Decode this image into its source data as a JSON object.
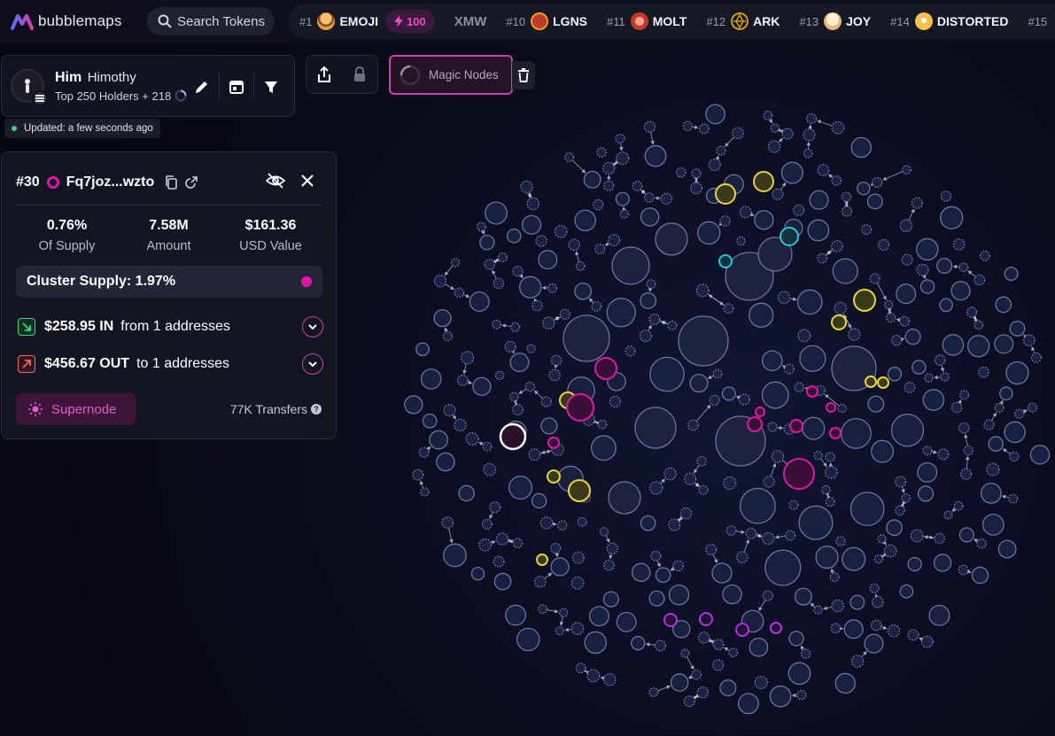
{
  "app": {
    "logo_text": "bubblemaps"
  },
  "header": {
    "search_label": "Search Tokens",
    "ticker": [
      {
        "rank": "#1",
        "name": "EMOJI",
        "icon": "burger-emoji-icon",
        "color": "#e6a23c",
        "boost": "100"
      },
      {
        "rank": "",
        "name": "XMW",
        "icon": "",
        "color": "",
        "boost": ""
      },
      {
        "rank": "#10",
        "name": "LGNS",
        "icon": "lgns-token-icon",
        "color": "#c0392b",
        "boost": ""
      },
      {
        "rank": "#11",
        "name": "MOLT",
        "icon": "molt-token-icon",
        "color": "#e05a4a",
        "boost": ""
      },
      {
        "rank": "#12",
        "name": "ARK",
        "icon": "ark-token-icon",
        "color": "#d4a017",
        "boost": ""
      },
      {
        "rank": "#13",
        "name": "JOY",
        "icon": "joy-token-icon",
        "color": "#f0d9a8",
        "boost": ""
      },
      {
        "rank": "#14",
        "name": "DISTORTED",
        "icon": "distorted-token-icon",
        "color": "#f5c04a",
        "boost": ""
      },
      {
        "rank": "#15",
        "name": "",
        "icon": "",
        "color": "",
        "boost": ""
      }
    ]
  },
  "holder": {
    "name": "Him",
    "alias": "Himothy",
    "subtitle": "Top 250 Holders + 218",
    "updated": "Updated: a few seconds ago"
  },
  "toolbar": {
    "magic_nodes_label": "Magic Nodes"
  },
  "detail": {
    "rank": "#30",
    "address": "Fq7joz...wzto",
    "stats": [
      {
        "value": "0.76%",
        "label": "Of Supply"
      },
      {
        "value": "7.58M",
        "label": "Amount"
      },
      {
        "value": "$161.36",
        "label": "USD Value"
      }
    ],
    "cluster_supply": "Cluster Supply: 1.97%",
    "inflow_amount": "$258.95 IN",
    "inflow_text": "from 1 addresses",
    "outflow_amount": "$456.67 OUT",
    "outflow_text": "to 1 addresses",
    "supernode_label": "Supernode",
    "transfers": "77K Transfers"
  },
  "colors": {
    "accent_pink": "#dd18a8",
    "cluster_yellow": "#e8d341",
    "cluster_cyan": "#2bc3d6",
    "cluster_purple": "#b133e0",
    "bubble_default": "#6f7aa8",
    "in_green": "#3fd47a",
    "out_red": "#f06a6a"
  }
}
